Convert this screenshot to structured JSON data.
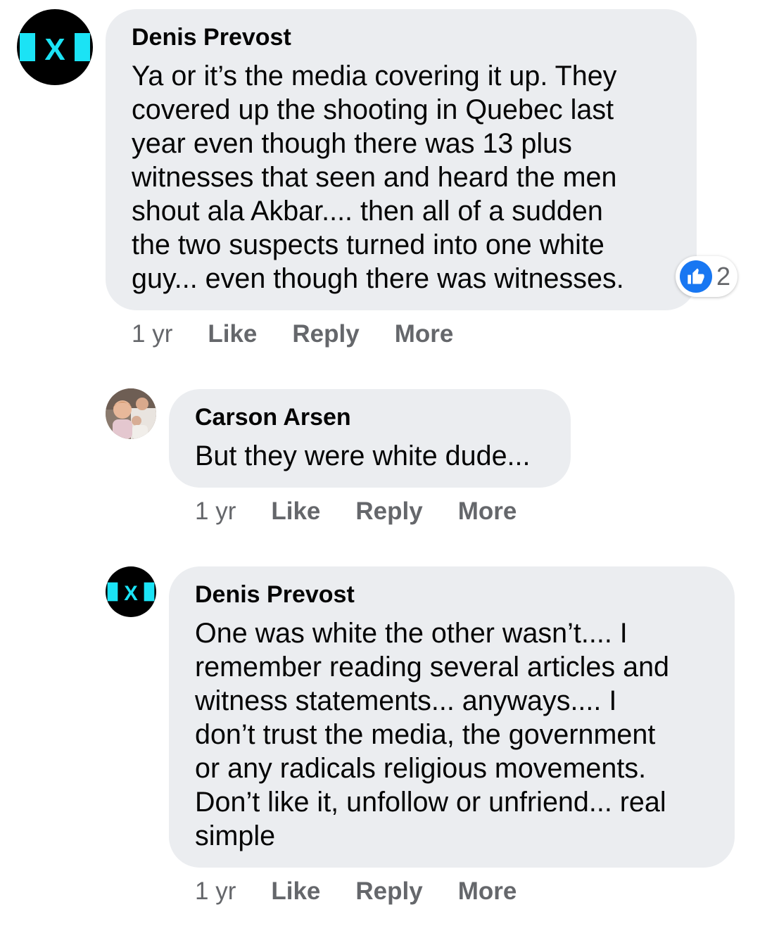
{
  "comments": [
    {
      "author": "Denis Prevost",
      "avatar": "x-logo-avatar",
      "text": "Ya or it’s the media covering it up. They\ncovered up the shooting in Quebec last\nyear even though there was 13 plus\nwitnesses that seen and heard the men\nshout ala Akbar.... then all of a sudden\nthe two suspects turned into one white\nguy... even though there was witnesses.",
      "reaction": {
        "icon": "like-icon",
        "count": "2"
      },
      "time": "1 yr",
      "actions": [
        "Like",
        "Reply",
        "More"
      ]
    },
    {
      "author": "Carson Arsen",
      "avatar": "photo-avatar",
      "text": "But they were white dude...",
      "time": "1 yr",
      "actions": [
        "Like",
        "Reply",
        "More"
      ]
    },
    {
      "author": "Denis Prevost",
      "avatar": "x-logo-avatar",
      "text": "One was white the other wasn’t.... I\nremember reading several articles and\nwitness statements... anyways.... I\ndon’t trust the media, the government\nor any radicals religious movements.\nDon’t like it, unfollow or unfriend... real\nsimple",
      "time": "1 yr",
      "actions": [
        "Like",
        "Reply",
        "More"
      ]
    }
  ],
  "colors": {
    "bubble": "#ebedf0",
    "meta": "#65676b",
    "like_blue": "#1877f2",
    "logo_cyan": "#1be3f5"
  }
}
